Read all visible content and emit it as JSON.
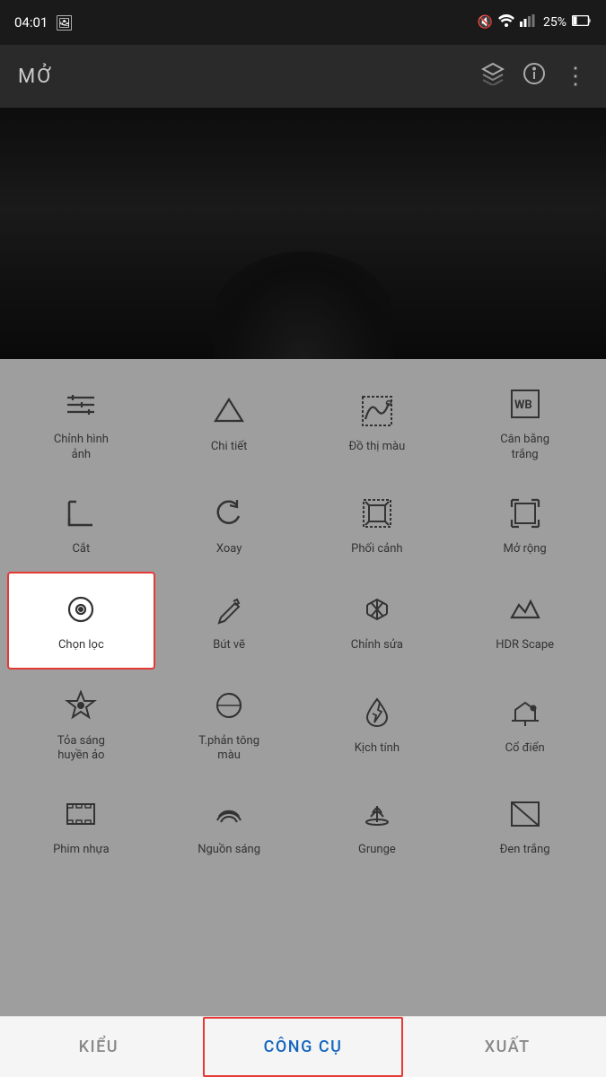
{
  "statusBar": {
    "time": "04:01",
    "battery": "25%"
  },
  "topBar": {
    "title": "MỞ",
    "icons": [
      "layers-icon",
      "info-icon",
      "more-icon"
    ]
  },
  "tools": [
    {
      "id": "chinh-hinh",
      "label": "Chỉnh hình\nảnh",
      "icon": "sliders"
    },
    {
      "id": "chi-tiet",
      "label": "Chi tiết",
      "icon": "triangle-down"
    },
    {
      "id": "do-thi-mau",
      "label": "Đồ thị màu",
      "icon": "curve"
    },
    {
      "id": "can-bang-trang",
      "label": "Cân bằng\ntrắng",
      "icon": "wb"
    },
    {
      "id": "cat",
      "label": "Cắt",
      "icon": "crop"
    },
    {
      "id": "xoay",
      "label": "Xoay",
      "icon": "rotate"
    },
    {
      "id": "phoi-canh",
      "label": "Phối cảnh",
      "icon": "perspective"
    },
    {
      "id": "mo-rong",
      "label": "Mở rộng",
      "icon": "expand"
    },
    {
      "id": "chon-loc",
      "label": "Chọn lọc",
      "icon": "filter",
      "selected": true
    },
    {
      "id": "but-ve",
      "label": "Bút vẽ",
      "icon": "brush"
    },
    {
      "id": "chinh-sua",
      "label": "Chỉnh sửa",
      "icon": "healing"
    },
    {
      "id": "hdr-scape",
      "label": "HDR Scape",
      "icon": "mountain"
    },
    {
      "id": "toa-sang",
      "label": "Tỏa sáng\nhuyền ảo",
      "icon": "glare"
    },
    {
      "id": "tphan-tong-mau",
      "label": "T.phản tông\nmàu",
      "icon": "tone"
    },
    {
      "id": "kich-tinh",
      "label": "Kịch tính",
      "icon": "drama"
    },
    {
      "id": "co-dien",
      "label": "Cổ điển",
      "icon": "vintage"
    },
    {
      "id": "phim-nhua",
      "label": "Phim nhựa",
      "icon": "film"
    },
    {
      "id": "nguon-sang",
      "label": "Nguồn sáng",
      "icon": "moustache"
    },
    {
      "id": "grunge",
      "label": "Grunge",
      "icon": "guitar"
    },
    {
      "id": "den-trang",
      "label": "Đen trắng",
      "icon": "bw"
    }
  ],
  "bottomNav": [
    {
      "id": "kieu",
      "label": "KIỂU",
      "active": false
    },
    {
      "id": "cong-cu",
      "label": "CÔNG CỤ",
      "active": true
    },
    {
      "id": "xuat",
      "label": "XUẤT",
      "active": false
    }
  ]
}
